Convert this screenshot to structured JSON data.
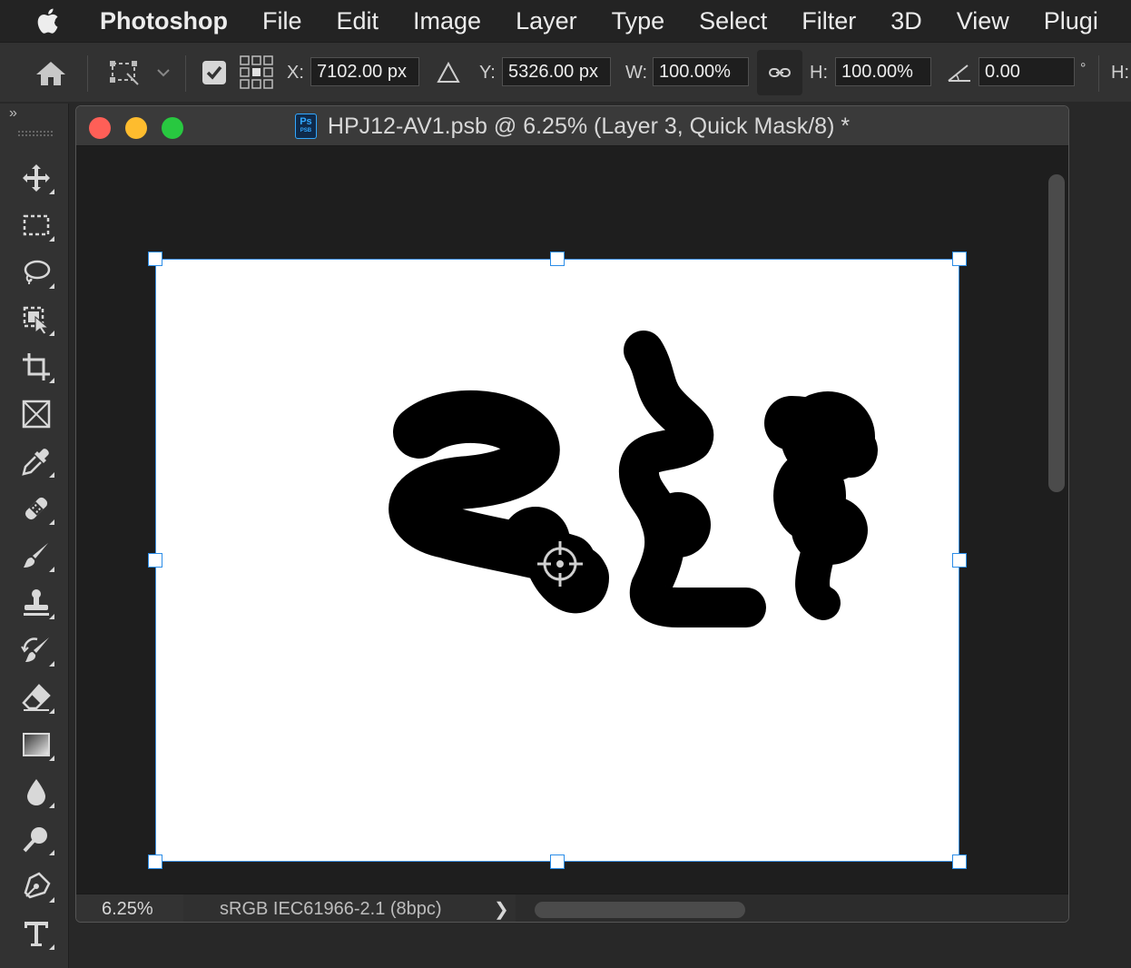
{
  "menubar": {
    "apple": "apple-icon",
    "items": [
      "Photoshop",
      "File",
      "Edit",
      "Image",
      "Layer",
      "Type",
      "Select",
      "Filter",
      "3D",
      "View",
      "Plugi"
    ]
  },
  "options": {
    "x_label": "X:",
    "x_value": "7102.00 px",
    "y_label": "Y:",
    "y_value": "5326.00 px",
    "w_label": "W:",
    "w_value": "100.00%",
    "h_label": "H:",
    "h_value": "100.00%",
    "angle_value": "0.00",
    "angle_unit": "°",
    "h2_label": "H:"
  },
  "document": {
    "title": "HPJ12-AV1.psb @ 6.25% (Layer 3, Quick Mask/8) *",
    "ps_icon_label": "Ps",
    "ps_icon_sub": "PSB"
  },
  "status": {
    "zoom": "6.25%",
    "profile": "sRGB IEC61966-2.1 (8bpc)",
    "arrow": "❯"
  },
  "tools": [
    "move-tool",
    "marquee-tool",
    "lasso-tool",
    "object-select-tool",
    "crop-tool",
    "frame-tool",
    "eyedropper-tool",
    "healing-tool",
    "brush-tool",
    "stamp-tool",
    "history-brush-tool",
    "eraser-tool",
    "gradient-tool",
    "blur-tool",
    "dodge-tool",
    "pen-tool",
    "type-tool"
  ],
  "colors": {
    "accent": "#2b8de8",
    "close": "#fe5f57",
    "minimize": "#febc2e",
    "zoom": "#28c840"
  }
}
